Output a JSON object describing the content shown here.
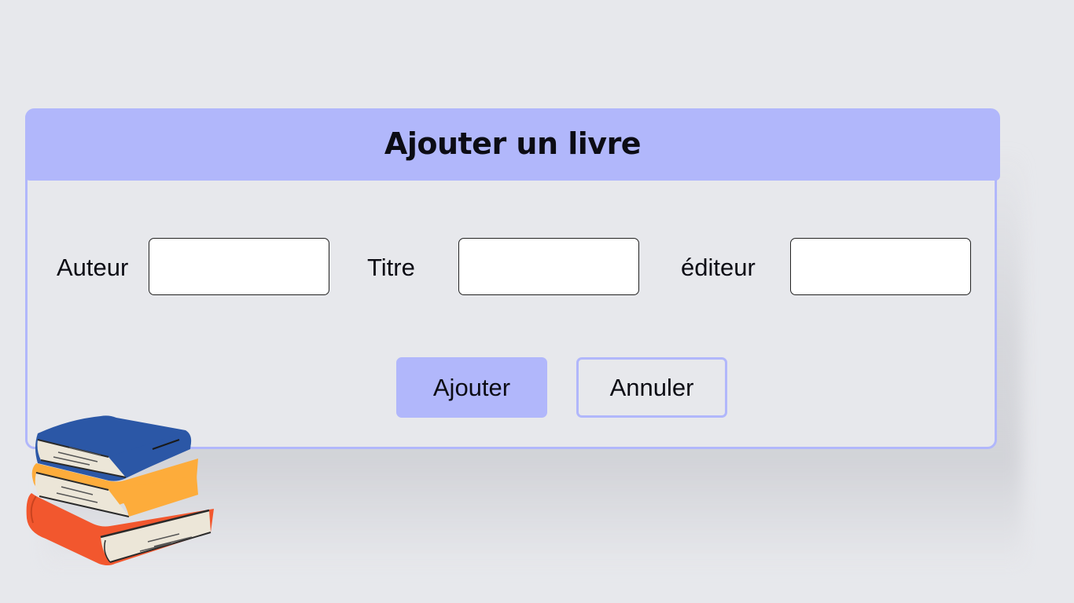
{
  "dialog": {
    "title": "Ajouter un livre"
  },
  "form": {
    "fields": [
      {
        "label": "Auteur",
        "value": "",
        "placeholder": ""
      },
      {
        "label": "Titre",
        "value": "",
        "placeholder": ""
      },
      {
        "label": "éditeur",
        "value": "",
        "placeholder": ""
      }
    ]
  },
  "actions": {
    "add_label": "Ajouter",
    "cancel_label": "Annuler"
  },
  "colors": {
    "background": "#e7e8ec",
    "accent": "#b1b7fb",
    "book_blue": "#2b57a6",
    "book_yellow": "#fdac3b",
    "book_orange": "#f2572e"
  },
  "illustration": {
    "icon": "books-stack-icon"
  }
}
